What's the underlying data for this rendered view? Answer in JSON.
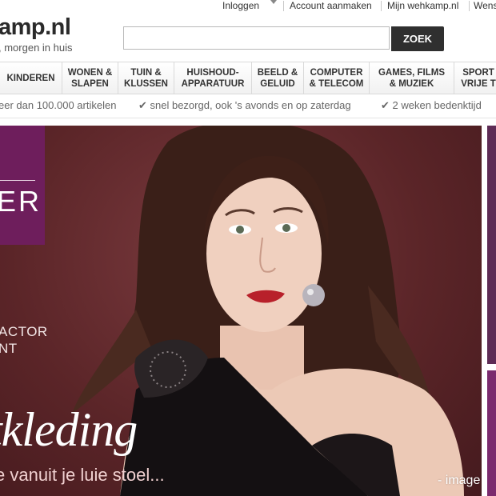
{
  "header": {
    "links": [
      "Inloggen",
      "Account aanmaken",
      "Mijn wehkamp.nl",
      "Wens"
    ],
    "logo": "amp.nl",
    "tagline": ", morgen in huis"
  },
  "search": {
    "value": "",
    "placeholder": "",
    "button_label": "ZOEK"
  },
  "nav": {
    "items": [
      {
        "label": "KINDEREN"
      },
      {
        "label": "WONEN &\nSLAPEN"
      },
      {
        "label": "TUIN &\nKLUSSEN"
      },
      {
        "label": "HUISHOUD-\nAPPARATUUR"
      },
      {
        "label": "BEELD &\nGELUID"
      },
      {
        "label": "COMPUTER\n& TELECOM"
      },
      {
        "label": "GAMES, FILMS\n& MUZIEK"
      },
      {
        "label": "SPORT\nVRIJE T"
      }
    ]
  },
  "usp": [
    "eer dan 100.000 artikelen",
    "✔ snel bezorgd, ook 's avonds en op zaterdag",
    "✔ 2 weken bedenktijd"
  ],
  "hero": {
    "badge_text": "ER",
    "actor_text": "ACTOR\nNT",
    "title": "tkleding",
    "subtitle": "e vanuit je luie stoel...",
    "watermark": "- image"
  },
  "colors": {
    "hero_bg": "#5b2528",
    "badge": "#6e1e5c",
    "search_button": "#2f2f2f"
  }
}
